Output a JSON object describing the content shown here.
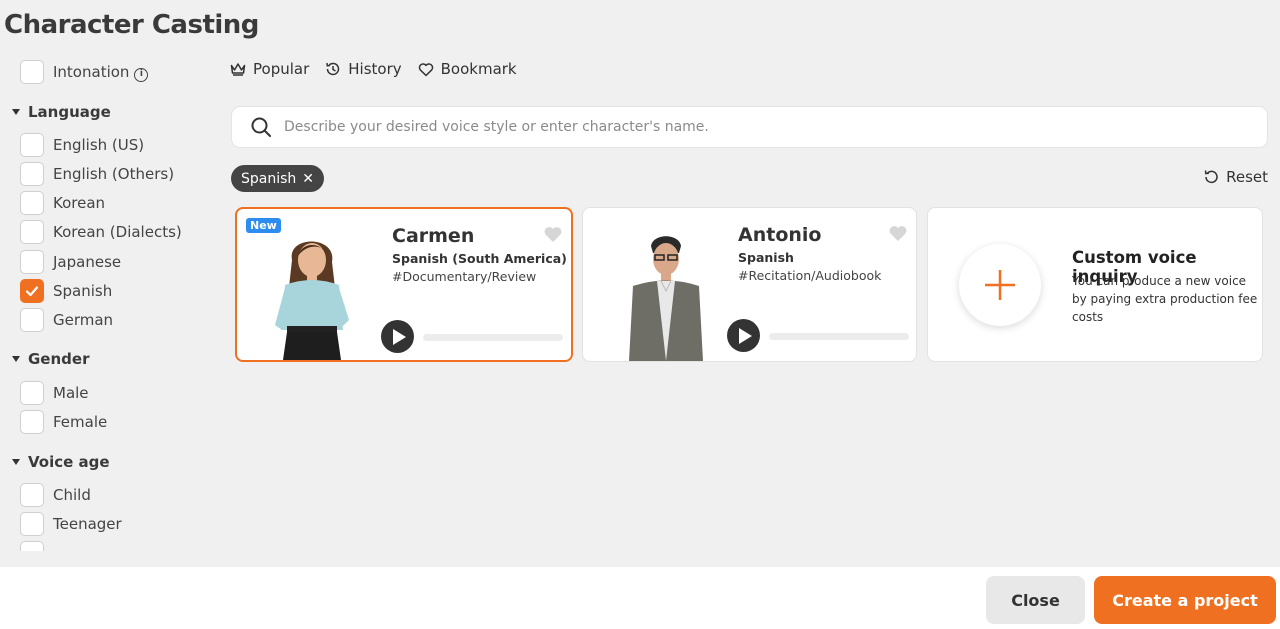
{
  "title": "Character Casting",
  "sidebar": {
    "intonation": {
      "label": "Intonation",
      "checked": false
    },
    "sections": [
      {
        "heading": "Language",
        "options": [
          {
            "label": "English (US)",
            "checked": false
          },
          {
            "label": "English (Others)",
            "checked": false
          },
          {
            "label": "Korean",
            "checked": false
          },
          {
            "label": "Korean (Dialects)",
            "checked": false
          },
          {
            "label": "Japanese",
            "checked": false
          },
          {
            "label": "Spanish",
            "checked": true
          },
          {
            "label": "German",
            "checked": false
          }
        ]
      },
      {
        "heading": "Gender",
        "options": [
          {
            "label": "Male",
            "checked": false
          },
          {
            "label": "Female",
            "checked": false
          }
        ]
      },
      {
        "heading": "Voice age",
        "options": [
          {
            "label": "Child",
            "checked": false
          },
          {
            "label": "Teenager",
            "checked": false
          }
        ]
      }
    ]
  },
  "topnav": {
    "popular": "Popular",
    "history": "History",
    "bookmark": "Bookmark"
  },
  "search": {
    "placeholder": "Describe your desired voice style or enter character's name.",
    "value": ""
  },
  "filter_chip": {
    "label": "Spanish"
  },
  "reset_label": "Reset",
  "cards": [
    {
      "badge": "New",
      "name": "Carmen",
      "language": "Spanish (South America)",
      "tag": "#Documentary/Review",
      "selected": true
    },
    {
      "badge": "",
      "name": "Antonio",
      "language": "Spanish",
      "tag": "#Recitation/Audiobook",
      "selected": false
    }
  ],
  "custom": {
    "title": "Custom voice inquiry",
    "description": "You can produce a new voice by paying extra production fee costs"
  },
  "footer": {
    "close": "Close",
    "create": "Create a project"
  },
  "colors": {
    "accent": "#f07021",
    "badge": "#2d8cf0",
    "chip": "#444444"
  }
}
